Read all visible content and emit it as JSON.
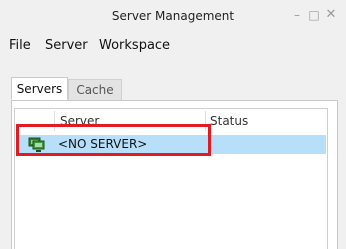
{
  "window": {
    "title": "Server Management",
    "minimize_icon": "minimize-icon",
    "maximize_icon": "maximize-icon",
    "close_icon": "close-icon"
  },
  "menu": [
    "File",
    "Server",
    "Workspace"
  ],
  "tabs": [
    {
      "label": "Servers",
      "active": true
    },
    {
      "label": "Cache",
      "active": false
    }
  ],
  "table": {
    "columns": [
      "Server",
      "Status"
    ],
    "rows": [
      {
        "icon": "server-icon",
        "server": "<NO SERVER>",
        "status": "",
        "selected": true
      }
    ]
  },
  "colors": {
    "selection": "#b7dffa",
    "annotation": "#e01b24"
  }
}
